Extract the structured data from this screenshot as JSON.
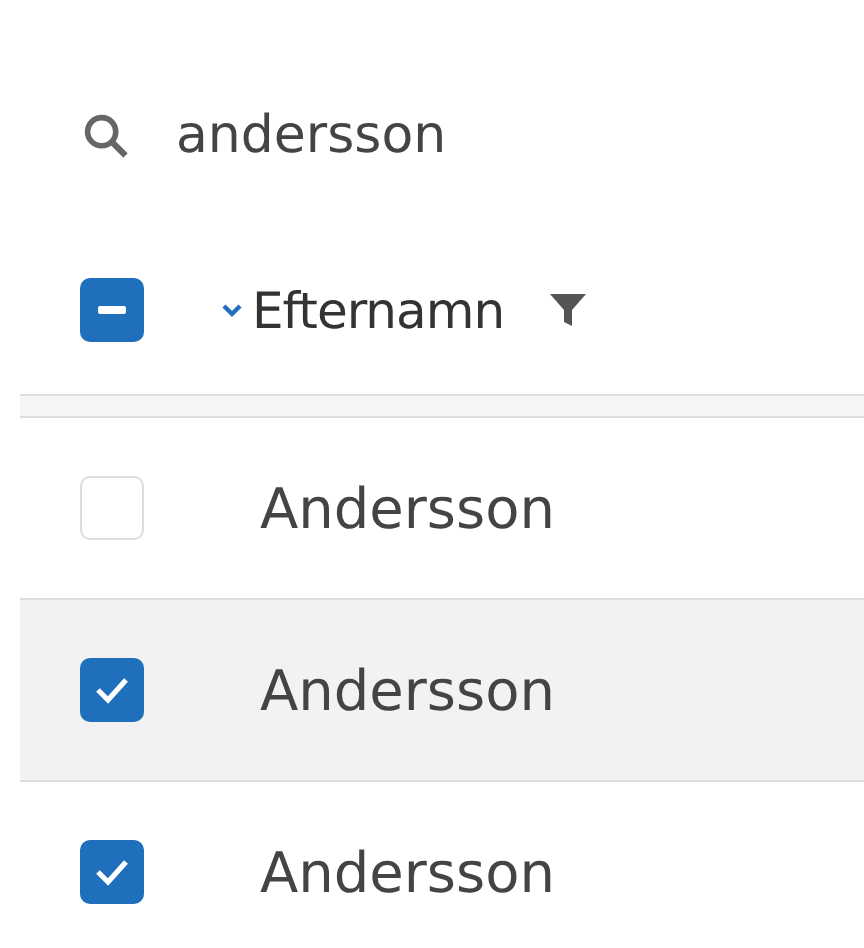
{
  "search": {
    "value": "andersson"
  },
  "header": {
    "indeterminate": true,
    "label": "Efternamn",
    "sort_descending": true
  },
  "rows": [
    {
      "name": "Andersson",
      "checked": false,
      "hovered": false
    },
    {
      "name": "Andersson",
      "checked": true,
      "hovered": true
    },
    {
      "name": "Andersson",
      "checked": true,
      "hovered": false
    }
  ]
}
